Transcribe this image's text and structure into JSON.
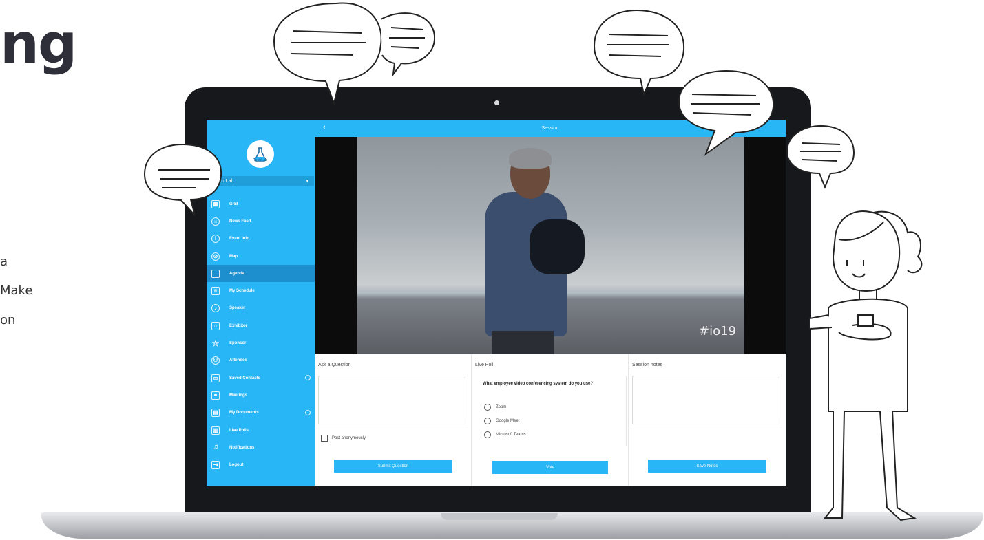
{
  "hero": {
    "heading_fragment": "ng",
    "paragraph_lines": [
      "a",
      "Make",
      "on"
    ]
  },
  "app": {
    "sidebar": {
      "logo_text": "TechLab",
      "event_name": "Tech Lab",
      "event_toggle": "▾",
      "items": [
        {
          "label": "Grid",
          "icon": "grid-icon"
        },
        {
          "label": "News Feed",
          "icon": "news-feed-icon"
        },
        {
          "label": "Event Info",
          "icon": "info-icon"
        },
        {
          "label": "Map",
          "icon": "map-icon"
        },
        {
          "label": "Agenda",
          "icon": "calendar-icon",
          "active": true
        },
        {
          "label": "My Schedule",
          "icon": "schedule-icon"
        },
        {
          "label": "Speaker",
          "icon": "microphone-icon"
        },
        {
          "label": "Exhibitor",
          "icon": "exhibitor-icon"
        },
        {
          "label": "Sponsor",
          "icon": "star-icon"
        },
        {
          "label": "Attendee",
          "icon": "person-icon"
        },
        {
          "label": "Saved Contacts",
          "icon": "contact-card-icon"
        },
        {
          "label": "Meetings",
          "icon": "meetings-icon"
        },
        {
          "label": "My Documents",
          "icon": "folder-icon"
        },
        {
          "label": "Live Polls",
          "icon": "poll-icon"
        },
        {
          "label": "Notifications",
          "icon": "bell-icon"
        },
        {
          "label": "Logout",
          "icon": "logout-icon"
        }
      ]
    },
    "topbar": {
      "back": "‹",
      "title": "Session"
    },
    "video": {
      "overlay_text": "#io19"
    },
    "ask_question": {
      "title": "Ask a Question",
      "checkbox_label": "Post anonymously",
      "button": "Submit Question"
    },
    "live_poll": {
      "title": "Live Poll",
      "question": "What employee video conferencing system do you use?",
      "options": [
        "Zoom",
        "Google Meet",
        "Microsoft Teams"
      ],
      "button": "Vote"
    },
    "session_notes": {
      "title": "Session notes",
      "button": "Save Notes"
    }
  },
  "colors": {
    "accent": "#29b6f6",
    "sidebar_active": "#1d8fce",
    "laptop_bezel": "#17181c"
  }
}
